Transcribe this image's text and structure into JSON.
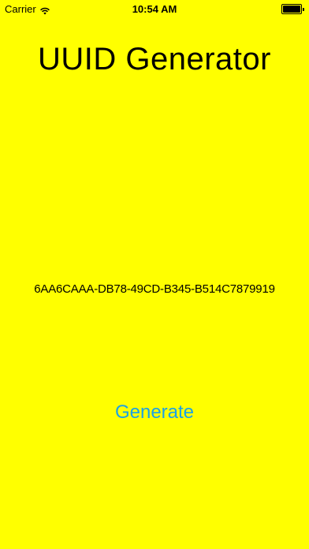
{
  "status_bar": {
    "carrier": "Carrier",
    "time": "10:54 AM",
    "battery_level": 1.0,
    "wifi_icon": "wifi-icon",
    "battery_icon": "battery-icon"
  },
  "main": {
    "title": "UUID Generator",
    "uuid": "6AA6CAAA-DB78-49CD-B345-B514C7879919",
    "generate_label": "Generate"
  },
  "colors": {
    "background": "#FFFF00",
    "button_text": "#1BA2E6"
  }
}
